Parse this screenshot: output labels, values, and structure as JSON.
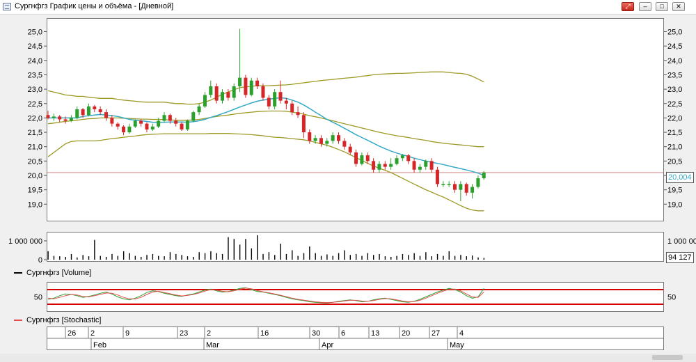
{
  "window": {
    "title": "Сургнфгз График цены и объёма - [Дневной]",
    "buttons": [
      "⤢",
      "–",
      "□",
      "✕"
    ]
  },
  "colors": {
    "up": "#2ca02c",
    "down": "#d62728",
    "ma": "#35a9c6",
    "band": "#9c9a25",
    "priceLine": "#d48a8a",
    "stoch1": "#2ca02c",
    "stoch2": "#e05050",
    "stochLevel": "#d40000"
  },
  "volume_legend": "Сургнфгз [Volume]",
  "stochastic_legend": "Сургнфгз [Stochastic]",
  "current_price_label": "20,004",
  "current_volume_label": "94 127",
  "time_axis": {
    "days": [
      "26",
      "2",
      "9",
      "23",
      "2",
      "16",
      "30",
      "6",
      "13",
      "20",
      "27",
      "4"
    ],
    "months": [
      "Feb",
      "Mar",
      "Apr",
      "May"
    ]
  },
  "chart_data": [
    {
      "type": "candlestick",
      "y_ticks": [
        "25,0",
        "24,5",
        "24,0",
        "23,5",
        "23,0",
        "22,5",
        "22,0",
        "21,5",
        "21,0",
        "20,5",
        "20,0",
        "19,5",
        "19,0"
      ],
      "ylim": [
        18.6,
        25.2
      ],
      "current_price": 20.1,
      "grid": false,
      "candles": [
        [
          22.1,
          22.0,
          22.25,
          21.95
        ],
        [
          22.0,
          22.05,
          22.15,
          21.9
        ],
        [
          22.05,
          21.95,
          22.1,
          21.85
        ],
        [
          21.95,
          21.9,
          22.05,
          21.8
        ],
        [
          21.9,
          22.0,
          22.1,
          21.85
        ],
        [
          22.0,
          22.3,
          22.4,
          21.95
        ],
        [
          22.3,
          22.1,
          22.35,
          22.0
        ],
        [
          22.1,
          22.4,
          22.5,
          22.05
        ],
        [
          22.4,
          22.3,
          22.45,
          22.2
        ],
        [
          22.3,
          22.2,
          22.4,
          22.1
        ],
        [
          22.2,
          22.0,
          22.3,
          21.9
        ],
        [
          22.0,
          21.8,
          22.1,
          21.7
        ],
        [
          21.8,
          21.7,
          21.85,
          21.6
        ],
        [
          21.7,
          21.5,
          21.75,
          21.4
        ],
        [
          21.5,
          21.7,
          21.8,
          21.45
        ],
        [
          21.7,
          21.9,
          21.95,
          21.65
        ],
        [
          21.9,
          21.8,
          21.95,
          21.7
        ],
        [
          21.8,
          21.6,
          21.85,
          21.5
        ],
        [
          21.6,
          21.7,
          21.8,
          21.55
        ],
        [
          21.7,
          21.9,
          22.0,
          21.65
        ],
        [
          21.9,
          22.1,
          22.2,
          21.85
        ],
        [
          22.1,
          21.9,
          22.15,
          21.8
        ],
        [
          21.9,
          21.8,
          22.0,
          21.7
        ],
        [
          21.8,
          21.6,
          21.85,
          21.55
        ],
        [
          21.6,
          21.9,
          21.95,
          21.55
        ],
        [
          21.9,
          22.2,
          22.25,
          21.85
        ],
        [
          22.2,
          22.4,
          22.5,
          22.1
        ],
        [
          22.4,
          22.8,
          22.9,
          22.35
        ],
        [
          22.8,
          23.1,
          23.3,
          22.7
        ],
        [
          23.1,
          22.6,
          23.2,
          22.5
        ],
        [
          22.6,
          22.9,
          23.0,
          22.5
        ],
        [
          22.9,
          22.7,
          23.0,
          22.6
        ],
        [
          22.7,
          23.1,
          23.2,
          22.6
        ],
        [
          23.1,
          23.4,
          25.1,
          22.9
        ],
        [
          23.4,
          22.8,
          23.5,
          22.7
        ],
        [
          22.8,
          23.3,
          23.4,
          22.75
        ],
        [
          23.3,
          23.1,
          23.4,
          23.0
        ],
        [
          23.1,
          22.7,
          23.2,
          22.6
        ],
        [
          22.7,
          22.4,
          22.8,
          22.3
        ],
        [
          22.4,
          22.9,
          23.0,
          22.3
        ],
        [
          22.9,
          22.6,
          23.3,
          22.5
        ],
        [
          22.6,
          22.5,
          22.7,
          22.3
        ],
        [
          22.5,
          22.2,
          22.6,
          22.1
        ],
        [
          22.2,
          22.1,
          22.4,
          22.0
        ],
        [
          22.1,
          21.5,
          22.2,
          21.3
        ],
        [
          21.5,
          21.2,
          21.6,
          21.1
        ],
        [
          21.2,
          21.3,
          21.4,
          21.1
        ],
        [
          21.3,
          21.1,
          21.4,
          21.0
        ],
        [
          21.1,
          21.2,
          21.3,
          21.0
        ],
        [
          21.2,
          21.4,
          21.5,
          21.1
        ],
        [
          21.4,
          21.2,
          21.5,
          21.1
        ],
        [
          21.2,
          21.0,
          21.3,
          20.9
        ],
        [
          21.0,
          20.8,
          21.1,
          20.7
        ],
        [
          20.8,
          20.4,
          20.9,
          20.3
        ],
        [
          20.4,
          20.7,
          20.8,
          20.35
        ],
        [
          20.7,
          20.5,
          20.8,
          20.4
        ],
        [
          20.5,
          20.2,
          20.6,
          20.1
        ],
        [
          20.2,
          20.4,
          20.5,
          20.1
        ],
        [
          20.4,
          20.3,
          20.5,
          20.2
        ],
        [
          20.3,
          20.4,
          20.6,
          20.2
        ],
        [
          20.4,
          20.6,
          20.7,
          20.35
        ],
        [
          20.6,
          20.7,
          20.75,
          20.5
        ],
        [
          20.7,
          20.5,
          20.75,
          20.4
        ],
        [
          20.5,
          20.2,
          20.6,
          20.1
        ],
        [
          20.2,
          20.3,
          20.4,
          20.1
        ],
        [
          20.3,
          20.5,
          20.55,
          20.2
        ],
        [
          20.5,
          20.2,
          20.6,
          20.1
        ],
        [
          20.2,
          19.7,
          20.3,
          19.6
        ],
        [
          19.7,
          19.7,
          19.8,
          19.6
        ],
        [
          19.7,
          19.7,
          19.8,
          19.6
        ],
        [
          19.7,
          19.5,
          19.8,
          19.4
        ],
        [
          19.5,
          19.7,
          19.8,
          19.1
        ],
        [
          19.7,
          19.4,
          19.75,
          19.3
        ],
        [
          19.4,
          19.6,
          19.7,
          19.2
        ],
        [
          19.6,
          19.9,
          20.0,
          19.55
        ],
        [
          19.9,
          20.1,
          20.15,
          19.85
        ]
      ],
      "moving_average": [
        22.0,
        22.0,
        22.0,
        22.0,
        22.0,
        22.0,
        22.05,
        22.08,
        22.1,
        22.12,
        22.1,
        22.08,
        22.05,
        22.0,
        21.95,
        21.92,
        21.9,
        21.88,
        21.85,
        21.85,
        21.85,
        21.86,
        21.86,
        21.86,
        21.85,
        21.87,
        21.9,
        21.95,
        22.02,
        22.08,
        22.15,
        22.22,
        22.3,
        22.38,
        22.45,
        22.52,
        22.58,
        22.62,
        22.65,
        22.68,
        22.7,
        22.68,
        22.62,
        22.55,
        22.45,
        22.33,
        22.2,
        22.08,
        21.95,
        21.85,
        21.75,
        21.64,
        21.53,
        21.42,
        21.32,
        21.22,
        21.12,
        21.02,
        20.93,
        20.85,
        20.78,
        20.72,
        20.66,
        20.6,
        20.55,
        20.5,
        20.46,
        20.42,
        20.38,
        20.33,
        20.28,
        20.24,
        20.19,
        20.14,
        20.08,
        20.0
      ],
      "band_upper": [
        22.95,
        22.9,
        22.85,
        22.8,
        22.78,
        22.75,
        22.75,
        22.72,
        22.7,
        22.68,
        22.68,
        22.68,
        22.65,
        22.62,
        22.6,
        22.58,
        22.56,
        22.55,
        22.55,
        22.55,
        22.55,
        22.52,
        22.5,
        22.5,
        22.48,
        22.48,
        22.5,
        22.55,
        22.62,
        22.72,
        22.82,
        22.9,
        22.98,
        23.05,
        23.08,
        23.1,
        23.12,
        23.12,
        23.12,
        23.13,
        23.14,
        23.15,
        23.17,
        23.2,
        23.22,
        23.25,
        23.27,
        23.3,
        23.32,
        23.34,
        23.36,
        23.38,
        23.4,
        23.42,
        23.45,
        23.47,
        23.5,
        23.52,
        23.53,
        23.54,
        23.55,
        23.55,
        23.56,
        23.57,
        23.58,
        23.59,
        23.6,
        23.6,
        23.6,
        23.58,
        23.56,
        23.55,
        23.52,
        23.45,
        23.35,
        23.25
      ],
      "band_middle": [
        21.8,
        21.82,
        21.85,
        21.88,
        21.9,
        21.92,
        21.95,
        21.97,
        21.98,
        22.0,
        22.0,
        22.0,
        22.0,
        21.99,
        21.98,
        21.97,
        21.96,
        21.96,
        21.95,
        21.95,
        21.94,
        21.93,
        21.92,
        21.92,
        21.92,
        21.93,
        21.95,
        21.98,
        22.02,
        22.05,
        22.08,
        22.1,
        22.13,
        22.16,
        22.18,
        22.2,
        22.22,
        22.23,
        22.24,
        22.24,
        22.24,
        22.23,
        22.2,
        22.17,
        22.13,
        22.08,
        22.04,
        22.0,
        21.95,
        21.9,
        21.85,
        21.8,
        21.75,
        21.7,
        21.65,
        21.6,
        21.55,
        21.5,
        21.46,
        21.42,
        21.38,
        21.35,
        21.32,
        21.28,
        21.25,
        21.22,
        21.18,
        21.15,
        21.12,
        21.1,
        21.08,
        21.06,
        21.04,
        21.02,
        21.0,
        21.0
      ],
      "band_lower": [
        20.65,
        20.8,
        20.95,
        21.1,
        21.18,
        21.2,
        21.2,
        21.2,
        21.2,
        21.22,
        21.25,
        21.28,
        21.3,
        21.33,
        21.35,
        21.37,
        21.4,
        21.42,
        21.43,
        21.44,
        21.45,
        21.45,
        21.45,
        21.45,
        21.45,
        21.45,
        21.45,
        21.45,
        21.46,
        21.46,
        21.46,
        21.46,
        21.45,
        21.44,
        21.43,
        21.42,
        21.4,
        21.38,
        21.35,
        21.33,
        21.32,
        21.3,
        21.28,
        21.26,
        21.24,
        21.2,
        21.15,
        21.1,
        21.05,
        20.98,
        20.9,
        20.82,
        20.72,
        20.62,
        20.52,
        20.42,
        20.33,
        20.25,
        20.18,
        20.1,
        20.0,
        19.9,
        19.8,
        19.7,
        19.6,
        19.5,
        19.42,
        19.33,
        19.25,
        19.15,
        19.05,
        18.95,
        18.86,
        18.8,
        18.77,
        18.77
      ]
    },
    {
      "type": "bar",
      "y_ticks": [
        "1 000 000",
        "0"
      ],
      "ylim": [
        0,
        1400000
      ],
      "values": [
        450000,
        200000,
        180000,
        150000,
        300000,
        120000,
        250000,
        180000,
        1050000,
        200000,
        150000,
        300000,
        200000,
        450000,
        350000,
        200000,
        150000,
        250000,
        300000,
        200000,
        180000,
        400000,
        300000,
        250000,
        180000,
        150000,
        400000,
        350000,
        450000,
        350000,
        300000,
        1200000,
        1100000,
        800000,
        1100000,
        600000,
        1300000,
        300000,
        400000,
        250000,
        850000,
        300000,
        500000,
        200000,
        350000,
        700000,
        350000,
        200000,
        280000,
        200000,
        350000,
        500000,
        250000,
        300000,
        200000,
        350000,
        250000,
        300000,
        180000,
        150000,
        200000,
        300000,
        250000,
        350000,
        200000,
        400000,
        180000,
        300000,
        200000,
        450000,
        200000,
        250000,
        180000,
        220000,
        120000,
        94127
      ]
    },
    {
      "type": "line",
      "y_ticks": [
        "50"
      ],
      "ylim": [
        0,
        100
      ],
      "levels": [
        80,
        20
      ],
      "series": [
        {
          "values": [
            40,
            45,
            55,
            62,
            60,
            55,
            48,
            52,
            58,
            65,
            70,
            62,
            50,
            42,
            38,
            45,
            55,
            68,
            75,
            72,
            65,
            60,
            55,
            52,
            58,
            62,
            70,
            78,
            82,
            75,
            70,
            72,
            78,
            85,
            88,
            80,
            72,
            70,
            65,
            60,
            55,
            48,
            42,
            38,
            35,
            30,
            28,
            26,
            25,
            28,
            32,
            35,
            38,
            35,
            30,
            32,
            38,
            42,
            45,
            40,
            35,
            30,
            28,
            32,
            40,
            50,
            60,
            70,
            78,
            85,
            80,
            70,
            55,
            45,
            50,
            85
          ]
        },
        {
          "values": [
            45,
            42,
            48,
            55,
            60,
            58,
            52,
            50,
            55,
            60,
            66,
            65,
            58,
            48,
            42,
            42,
            48,
            60,
            70,
            73,
            68,
            63,
            58,
            54,
            56,
            60,
            66,
            74,
            80,
            78,
            73,
            71,
            75,
            81,
            86,
            83,
            76,
            71,
            67,
            62,
            57,
            51,
            45,
            40,
            37,
            33,
            30,
            28,
            27,
            28,
            30,
            33,
            36,
            36,
            33,
            32,
            35,
            40,
            43,
            42,
            38,
            33,
            30,
            31,
            36,
            45,
            55,
            65,
            74,
            81,
            82,
            75,
            62,
            50,
            48,
            70
          ]
        }
      ]
    }
  ]
}
